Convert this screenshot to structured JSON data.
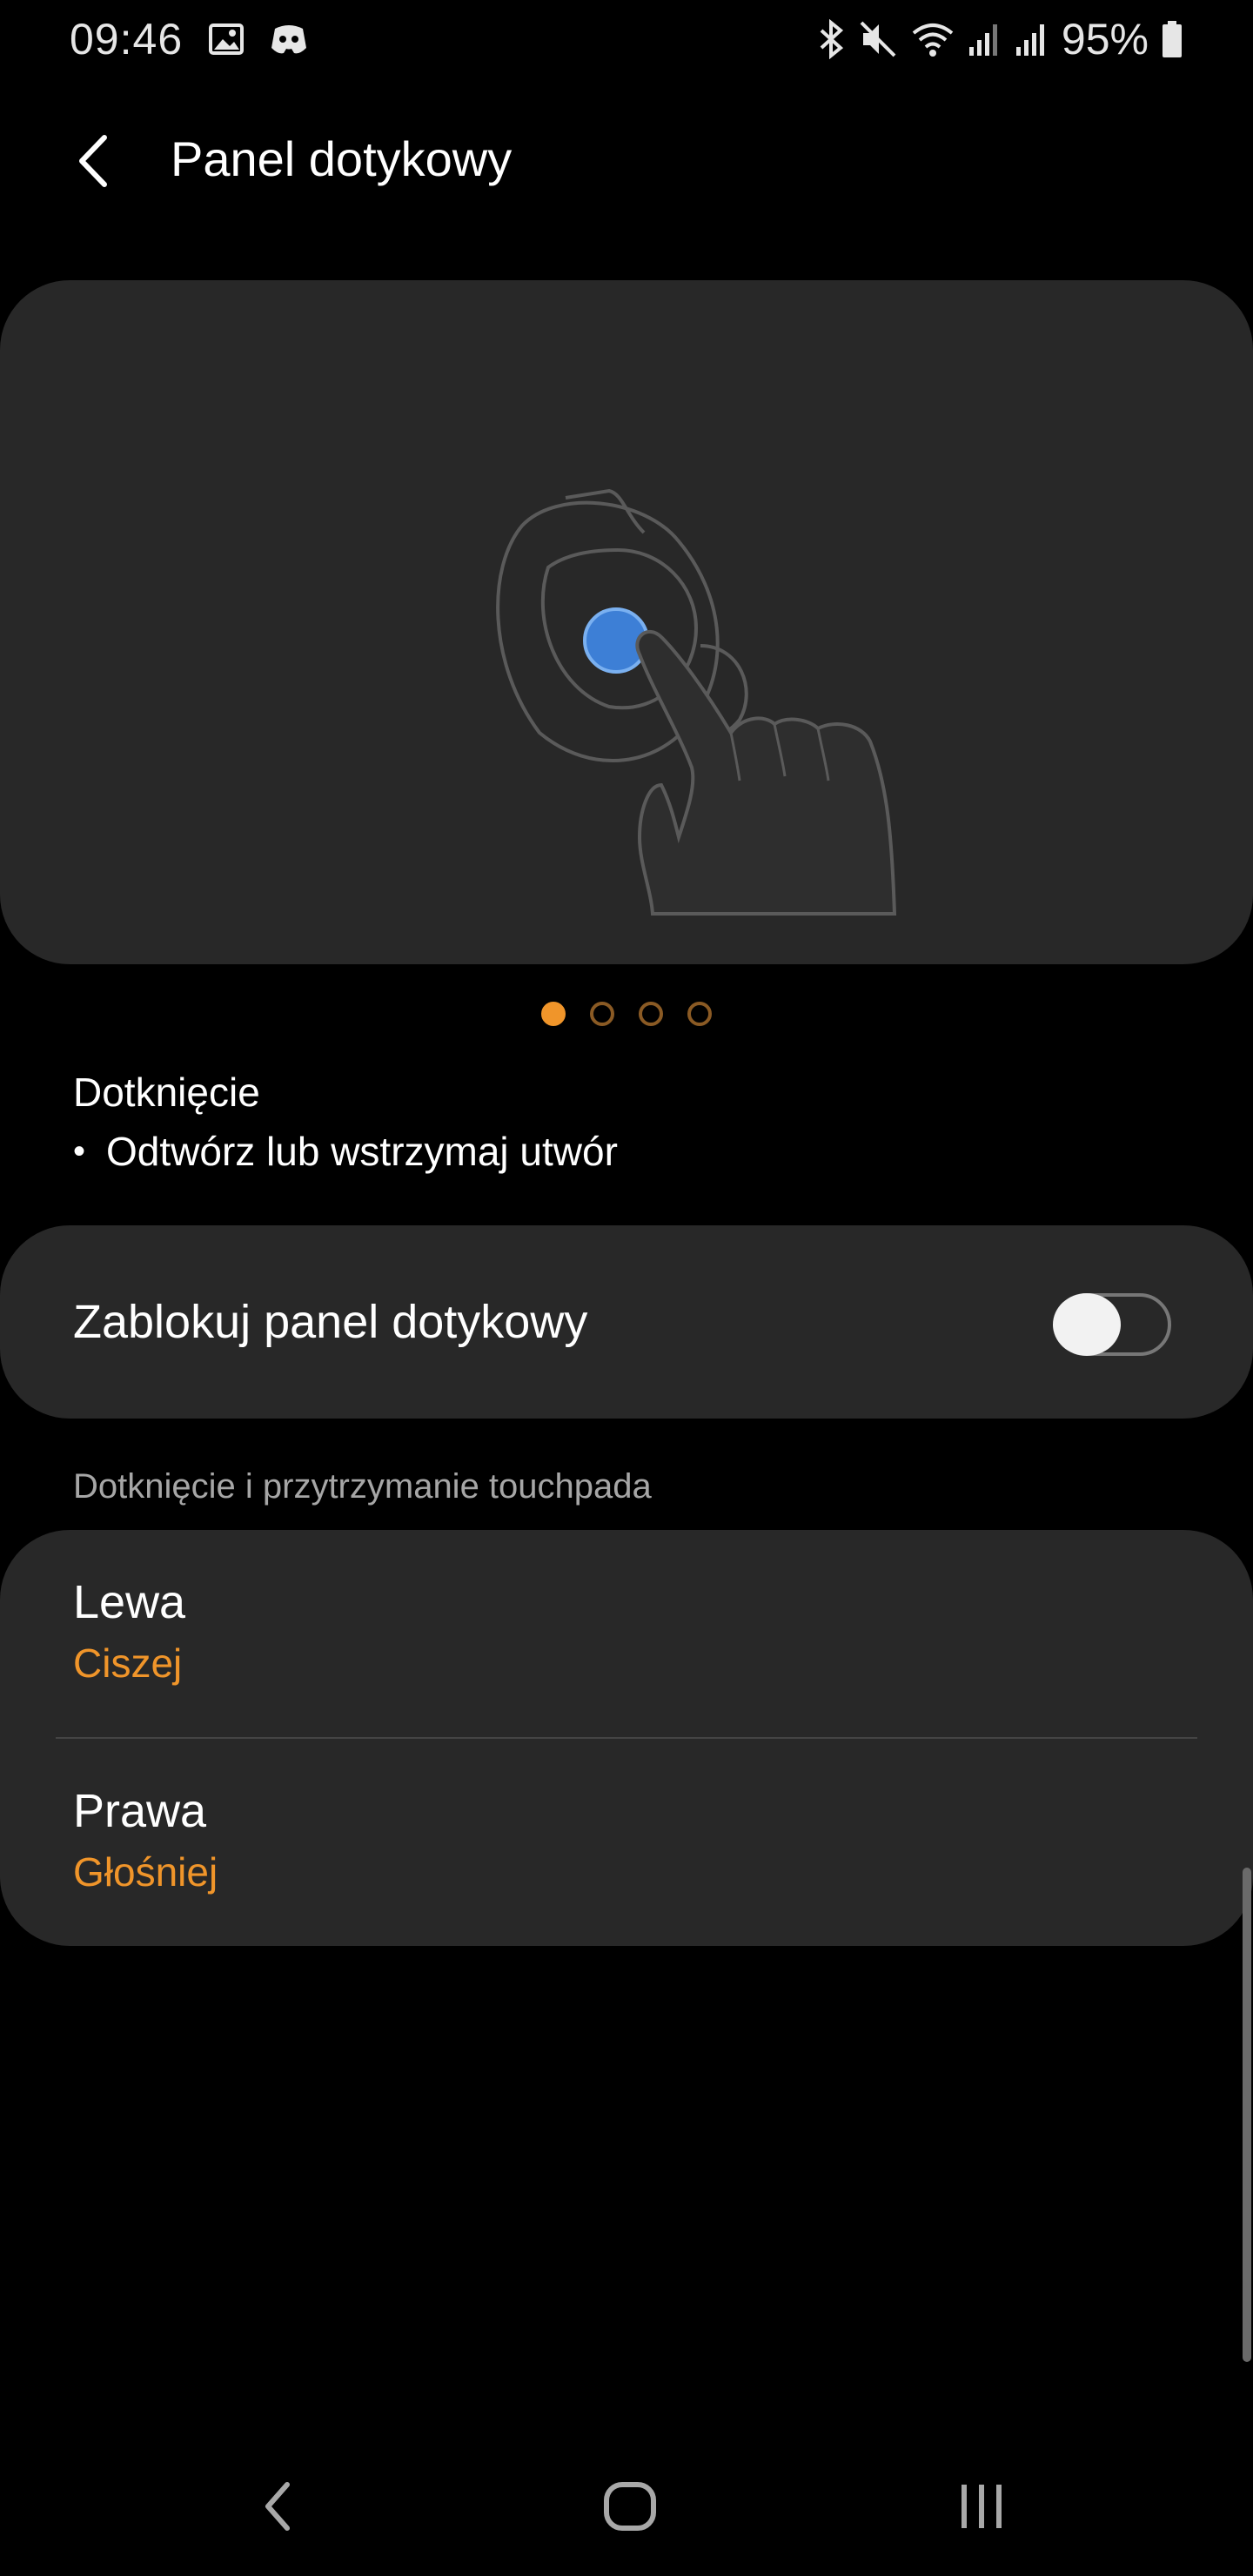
{
  "status_bar": {
    "time": "09:46",
    "battery": "95%",
    "icons_left": [
      "image-icon",
      "discord-icon"
    ],
    "icons_right": [
      "bluetooth-icon",
      "mute-icon",
      "wifi-icon",
      "signal-icon",
      "signal-icon",
      "battery-icon"
    ]
  },
  "header": {
    "title": "Panel dotykowy"
  },
  "illustration": {
    "icon": "earbud-touch-illustration",
    "accent_color": "#3d7fd6"
  },
  "pager": {
    "count": 4,
    "active_index": 0,
    "active_color": "#f0952a"
  },
  "gesture": {
    "title": "Dotknięcie",
    "bullet": "Odtwórz lub wstrzymaj utwór"
  },
  "lock": {
    "label": "Zablokuj panel dotykowy",
    "enabled": false
  },
  "section": {
    "header": "Dotknięcie i przytrzymanie touchpada"
  },
  "options": [
    {
      "title": "Lewa",
      "value": "Ciszej"
    },
    {
      "title": "Prawa",
      "value": "Głośniej"
    }
  ],
  "colors": {
    "background": "#000000",
    "card": "#282828",
    "accent": "#f0952a"
  }
}
